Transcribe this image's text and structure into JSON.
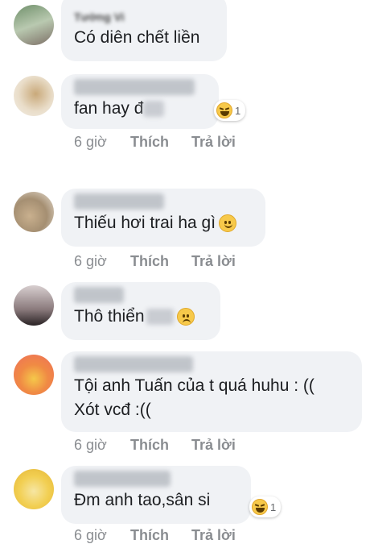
{
  "comments": [
    {
      "name": "Tường Vi",
      "text": "Có diên chết liền",
      "time": "",
      "like": "",
      "reply": ""
    },
    {
      "name": "",
      "text": "fan hay đ",
      "reaction": {
        "count": "1",
        "icon": "haha-icon"
      },
      "time": "6 giờ",
      "like": "Thích",
      "reply": "Trả lời"
    },
    {
      "name": "",
      "text": "Thiếu hơi trai ha gì",
      "emoji": "smile-emoji",
      "time": "6 giờ",
      "like": "Thích",
      "reply": "Trả lời"
    },
    {
      "name": "",
      "text": "Thô thiển",
      "emoji": "sad-emoji",
      "time": "",
      "like": "",
      "reply": ""
    },
    {
      "name": "",
      "text": "Tội anh Tuấn của t quá huhu : (( Xót vcđ :((",
      "time": "6 giờ",
      "like": "Thích",
      "reply": "Trả lời"
    },
    {
      "name": "",
      "text": "Đm anh tao,sân si",
      "reaction": {
        "count": "1",
        "icon": "haha-icon"
      },
      "time": "6 giờ",
      "like": "Thích",
      "reply": "Trả lời"
    }
  ],
  "colors": {
    "bubble": "#f0f2f5",
    "meta": "#8a8d91",
    "text": "#1c1e21"
  }
}
